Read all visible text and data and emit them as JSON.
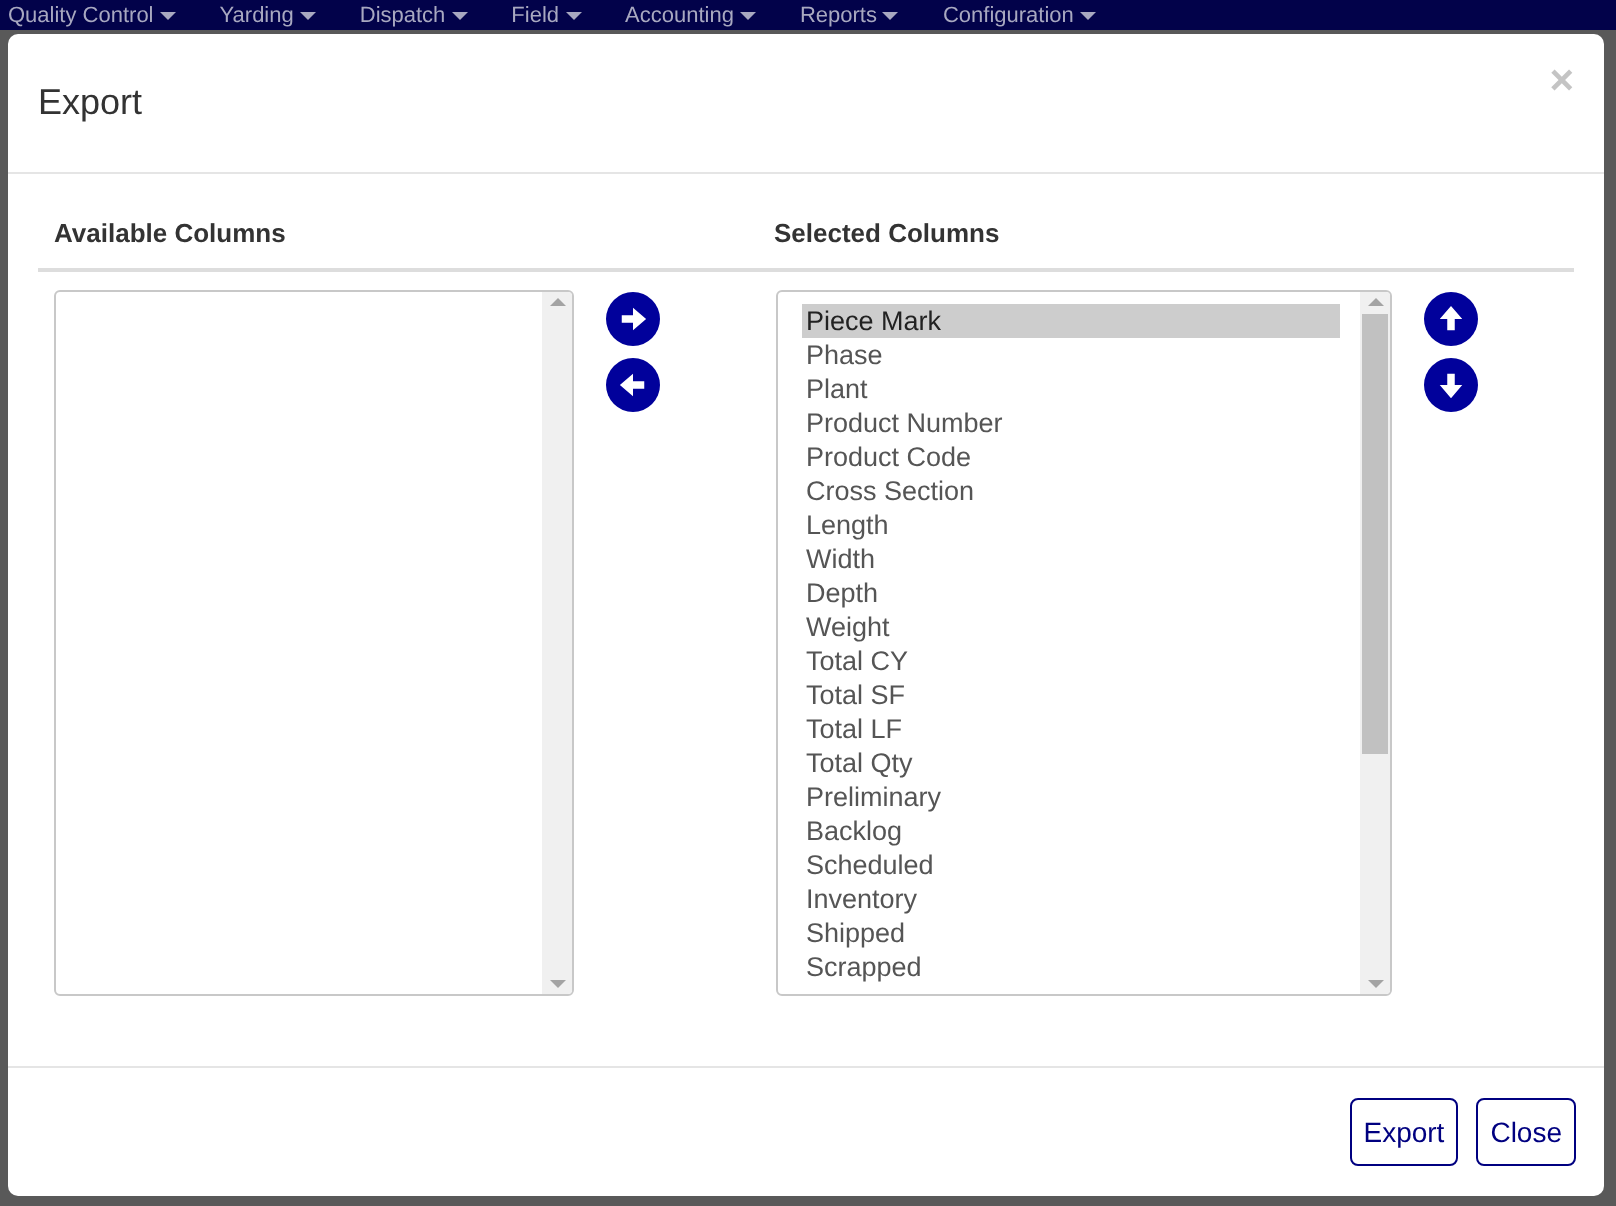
{
  "nav": {
    "items": [
      "Quality Control",
      "Yarding",
      "Dispatch",
      "Field",
      "Accounting",
      "Reports",
      "Configuration"
    ]
  },
  "dialog": {
    "title": "Export",
    "close": "×"
  },
  "available": {
    "heading": "Available Columns"
  },
  "selected_list": {
    "heading": "Selected Columns",
    "items": [
      {
        "label": "Piece Mark",
        "selected": true
      },
      {
        "label": "Phase",
        "selected": false
      },
      {
        "label": "Plant",
        "selected": false
      },
      {
        "label": "Product Number",
        "selected": false
      },
      {
        "label": "Product Code",
        "selected": false
      },
      {
        "label": "Cross Section",
        "selected": false
      },
      {
        "label": "Length",
        "selected": false
      },
      {
        "label": "Width",
        "selected": false
      },
      {
        "label": "Depth",
        "selected": false
      },
      {
        "label": "Weight",
        "selected": false
      },
      {
        "label": "Total CY",
        "selected": false
      },
      {
        "label": "Total SF",
        "selected": false
      },
      {
        "label": "Total LF",
        "selected": false
      },
      {
        "label": "Total Qty",
        "selected": false
      },
      {
        "label": "Preliminary",
        "selected": false
      },
      {
        "label": "Backlog",
        "selected": false
      },
      {
        "label": "Scheduled",
        "selected": false
      },
      {
        "label": "Inventory",
        "selected": false
      },
      {
        "label": "Shipped",
        "selected": false
      },
      {
        "label": "Scrapped",
        "selected": false
      }
    ]
  },
  "buttons": [
    "Export",
    "Close"
  ]
}
